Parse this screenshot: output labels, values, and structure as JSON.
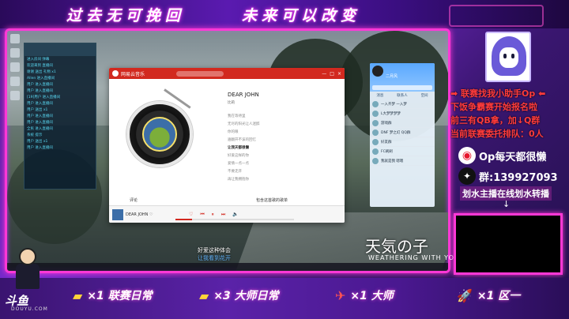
{
  "banner": {
    "left_text": "过去无可挽回",
    "right_text": "未来可以改变"
  },
  "music_app": {
    "app_name": "网易云音乐",
    "controls": [
      "—",
      "□",
      "×"
    ],
    "song_title": "DEAR JOHN",
    "song_artist": "比莉",
    "mini_song": "DEAR JOHN ♡",
    "lyrics": [
      "我在等待里",
      "无尽的阳光让人迷醉",
      "你的眼",
      "遍翻开不该的回忆",
      "让我天都很懒",
      "好爱这样的你",
      "爱情一点一点",
      "不要走开",
      "再让我拥抱你"
    ],
    "tab_comments": "评论",
    "tab_similar": "包含这首歌的歌单",
    "progress": 0.14
  },
  "qq": {
    "name": "二月风",
    "tabs": [
      "消息",
      "联系人",
      "空间"
    ],
    "items": [
      "一入齐梦 一入梦",
      "L大梦梦梦梦",
      "游戏群",
      "DNF 梦之幻 QQ群",
      "好友群",
      "FC刷刷",
      "我就是我 嗯嗯"
    ]
  },
  "overlay": {
    "subtitle_1": "好爱这种体会",
    "subtitle_2": "让我看到花开",
    "movie_jp": "天気の子",
    "movie_en": "WEATHERING WITH YOU"
  },
  "side_panel": {
    "lines": [
      "进入房间 弹幕",
      "欢迎来到 直播间",
      "谢谢 送出 礼物 x1",
      "Allen 进入直播间",
      "用户 进入直播间",
      "用户 进入直播间",
      "[19]用户 进入直播间",
      "用户 进入直播间",
      "用户 送出 x1",
      "用户 进入直播间",
      "用户 进入直播间",
      "全民 进入直播间",
      "系统 提示",
      "用户 送出 x1",
      "用户 进入直播间"
    ]
  },
  "right_column": {
    "promo_1": "➡ 联赛找我小助手Op ⬅",
    "promo_2": "下饭争霸赛开始报名啦",
    "promo_3": "前三有QB拿，加↓Q群",
    "promo_4": "当前联赛委托排队：0人",
    "weibo": "Op每天都很懒",
    "qq_group": "群:139927093",
    "relay": "划水主播在线划水转播",
    "arrow": "↓"
  },
  "rewards": [
    {
      "icon": "gold-bar-icon",
      "glyph": "▰",
      "text": "×1 联赛日常"
    },
    {
      "icon": "gold-bar-icon",
      "glyph": "▰",
      "text": "×3 大师日常"
    },
    {
      "icon": "airplane-icon",
      "glyph": "✈",
      "text": "×1 大师"
    },
    {
      "icon": "rocket-icon",
      "glyph": "🚀",
      "text": "×1 区一"
    }
  ],
  "branding": {
    "logo": "斗鱼",
    "logo_sub": "DOUYU.COM"
  },
  "colors": {
    "neon_pink": "#ff38d6",
    "netease_red": "#d2291f",
    "purple_bg": "#5a22a8"
  }
}
